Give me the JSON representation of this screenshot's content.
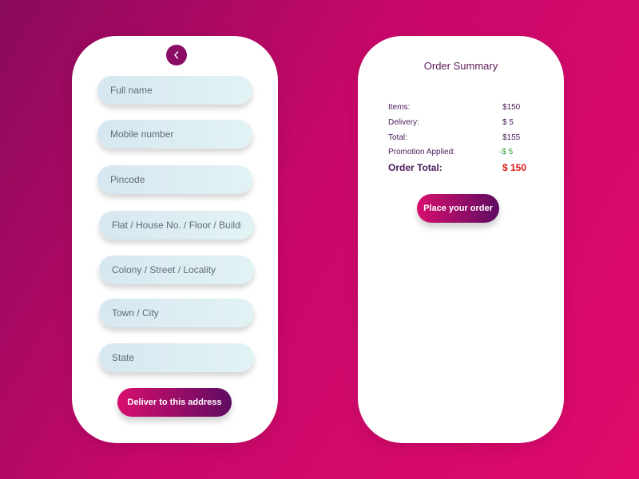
{
  "address_form": {
    "back_icon": "chevron-left-icon",
    "fields": [
      {
        "placeholder": "Full name"
      },
      {
        "placeholder": "Mobile number"
      },
      {
        "placeholder": "Pincode"
      },
      {
        "placeholder": "Flat / House No. / Floor / Building"
      },
      {
        "placeholder": "Colony / Street / Locality"
      },
      {
        "placeholder": "Town / City"
      },
      {
        "placeholder": "State"
      }
    ],
    "submit_label": "Deliver to this address"
  },
  "order_summary": {
    "title": "Order Summary",
    "rows": [
      {
        "label": "Items:",
        "value": "$150"
      },
      {
        "label": "Delivery:",
        "value": "$ 5"
      },
      {
        "label": "Total:",
        "value": "$155"
      },
      {
        "label": "Promotion Applied:",
        "value": "-$ 5"
      }
    ],
    "total": {
      "label": "Order Total:",
      "value": "$ 150"
    },
    "place_order_label": "Place your order"
  },
  "colors": {
    "background_start": "#8a0a5a",
    "background_end": "#e00a6c",
    "button_start": "#d80e6e",
    "button_end": "#5f0c62",
    "promotion": "#2e9a3a",
    "order_total": "#e01616"
  }
}
